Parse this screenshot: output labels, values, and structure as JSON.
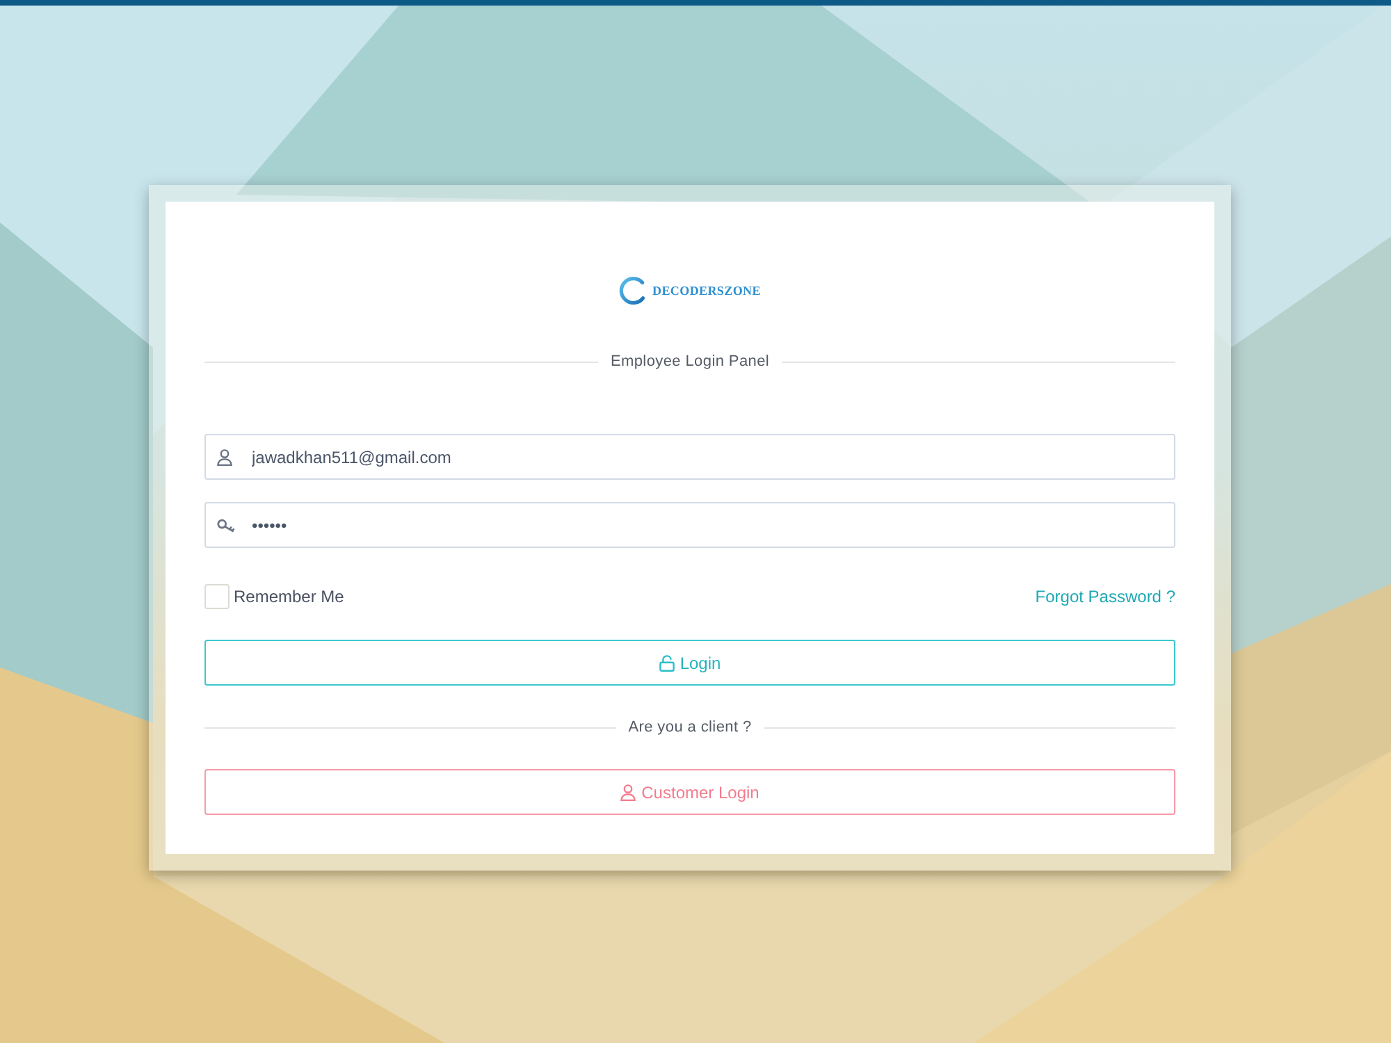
{
  "logo": {
    "text": "DECODERSZONE"
  },
  "panel_title": "Employee Login Panel",
  "fields": [
    {
      "kind": "email",
      "value": "jawadkhan511@gmail.com"
    },
    {
      "kind": "password",
      "value": "••••••"
    }
  ],
  "remember_me": {
    "label": "Remember Me",
    "checked": false
  },
  "forgot_password": "Forgot Password ?",
  "login_button": {
    "label": "Login"
  },
  "client_divider": "Are you a client ?",
  "customer_login_button": {
    "label": "Customer Login"
  }
}
